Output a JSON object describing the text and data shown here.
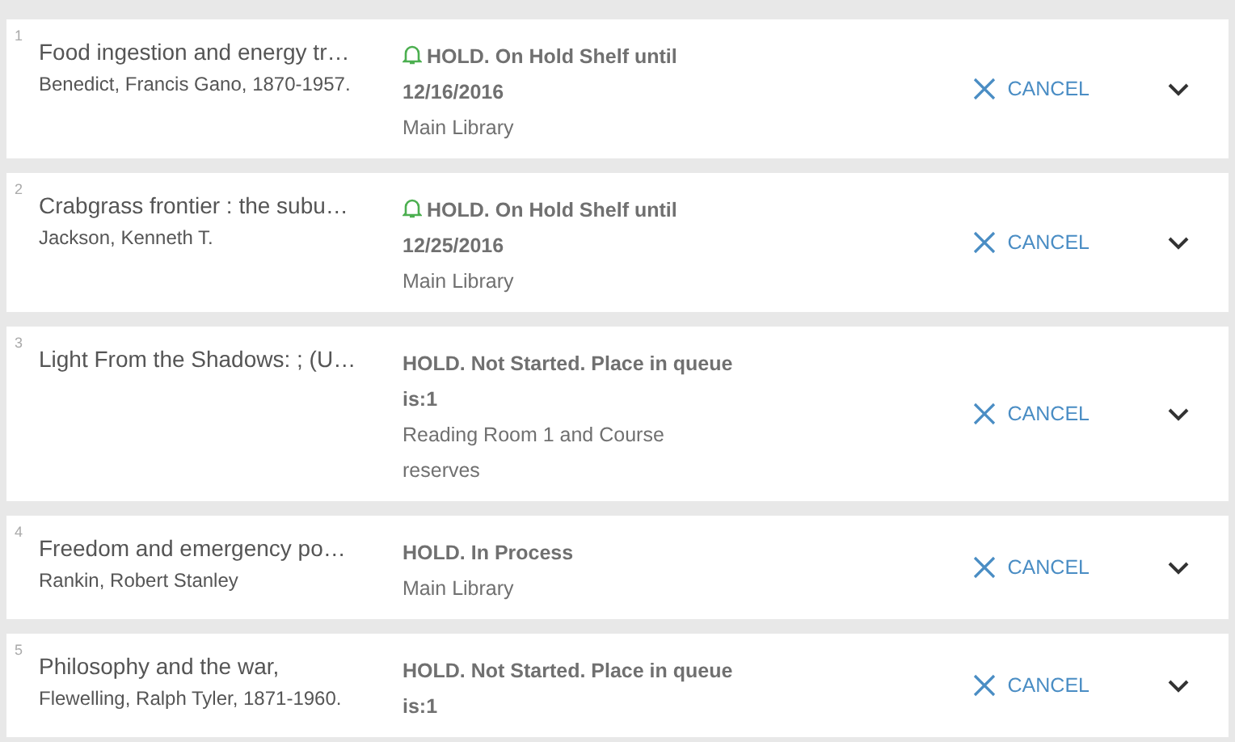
{
  "requests": [
    {
      "number": "1",
      "title": "Food ingestion and energy tr…",
      "author": "Benedict, Francis Gano, 1870-1957.",
      "bell": true,
      "status": "HOLD. On Hold Shelf until 12/16/2016",
      "location": "Main Library",
      "action": "CANCEL"
    },
    {
      "number": "2",
      "title": "Crabgrass frontier : the subu…",
      "author": "Jackson, Kenneth T.",
      "bell": true,
      "status": "HOLD. On Hold Shelf until 12/25/2016",
      "location": "Main Library",
      "action": "CANCEL"
    },
    {
      "number": "3",
      "title": "Light From the Shadows: ; (U…",
      "bell": false,
      "status": "HOLD. Not Started. Place in queue is:1",
      "location": "Reading Room 1 and Course reserves",
      "action": "CANCEL"
    },
    {
      "number": "4",
      "title": "Freedom and emergency po…",
      "author": "Rankin, Robert Stanley",
      "bell": false,
      "status": "HOLD. In Process",
      "location": "Main Library",
      "action": "CANCEL"
    },
    {
      "number": "5",
      "title": "Philosophy and the war,",
      "author": "Flewelling, Ralph Tyler, 1871-1960.",
      "bell": false,
      "status": "HOLD. Not Started. Place in queue is:1",
      "action": "CANCEL"
    }
  ]
}
